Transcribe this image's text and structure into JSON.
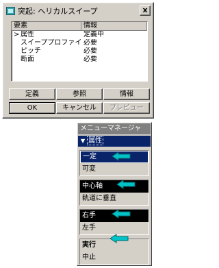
{
  "dialog": {
    "title": "突起: ヘリカルスイープ",
    "close_label": "x",
    "columns": [
      "要素",
      "情報"
    ],
    "rows": [
      {
        "marker": ">",
        "element": "属性",
        "info": "定義中"
      },
      {
        "marker": "",
        "element": "スイーププロファイ...",
        "info": "必要"
      },
      {
        "marker": "",
        "element": "ピッチ",
        "info": "必要"
      },
      {
        "marker": "",
        "element": "断面",
        "info": "必要"
      }
    ],
    "buttons": {
      "define": "定義",
      "refer": "参照",
      "info": "情報",
      "ok": "OK",
      "cancel": "キャンセル",
      "preview": "プレビュー"
    }
  },
  "menu": {
    "title": "メニューマネージャ",
    "submenu": "属性",
    "groups": [
      [
        "一定",
        "可変"
      ],
      [
        "中心軸",
        "軌道に垂直"
      ],
      [
        "右手",
        "左手"
      ],
      [
        "実行",
        "中止"
      ]
    ]
  },
  "colors": {
    "selection": "#0a246a",
    "arrow": "#00c2c7",
    "face": "#d4d0c8"
  }
}
